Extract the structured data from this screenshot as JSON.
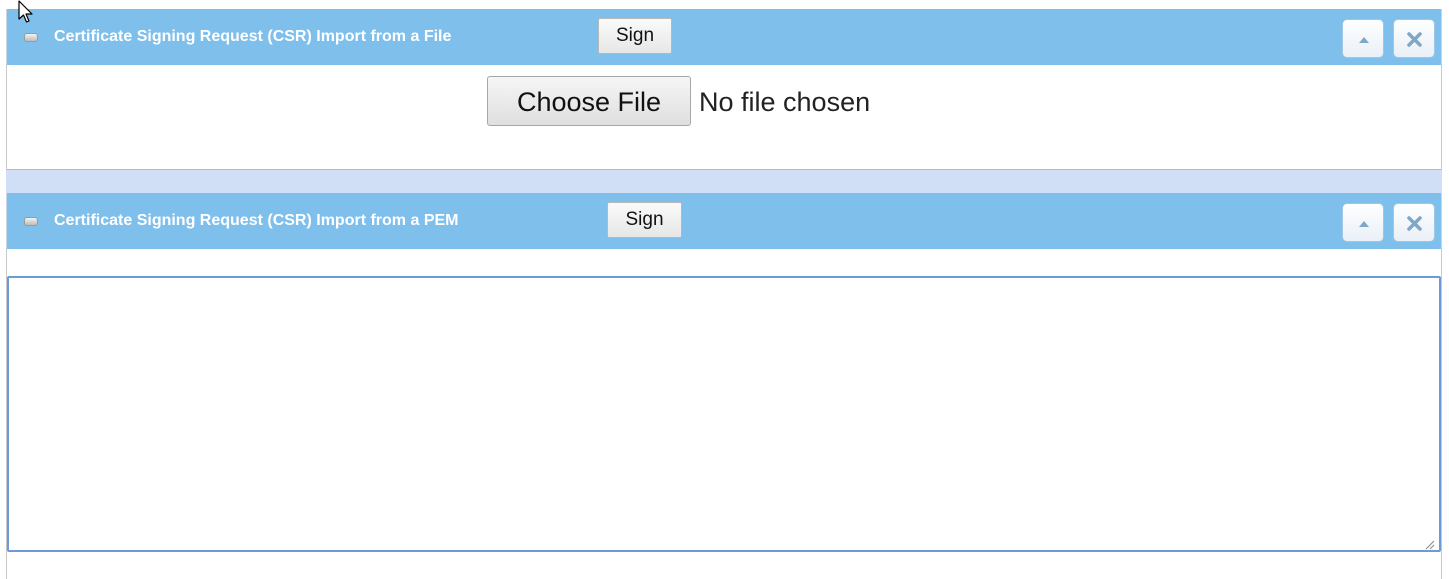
{
  "file_panel": {
    "title": "Certificate Signing Request (CSR) Import from a File",
    "sign_label": "Sign",
    "choose_file_label": "Choose File",
    "file_status": "No file chosen"
  },
  "pem_panel": {
    "title": "Certificate Signing Request (CSR) Import from a PEM",
    "sign_label": "Sign",
    "textarea_value": ""
  },
  "icons": {
    "collapse": "chevron-up-icon",
    "close": "close-icon",
    "bullet": "bullet-icon",
    "cursor": "mouse-pointer-icon"
  },
  "colors": {
    "header_bg": "#7fbfec",
    "separator_bg": "#d0def6",
    "textarea_border": "#6c9ad8"
  }
}
